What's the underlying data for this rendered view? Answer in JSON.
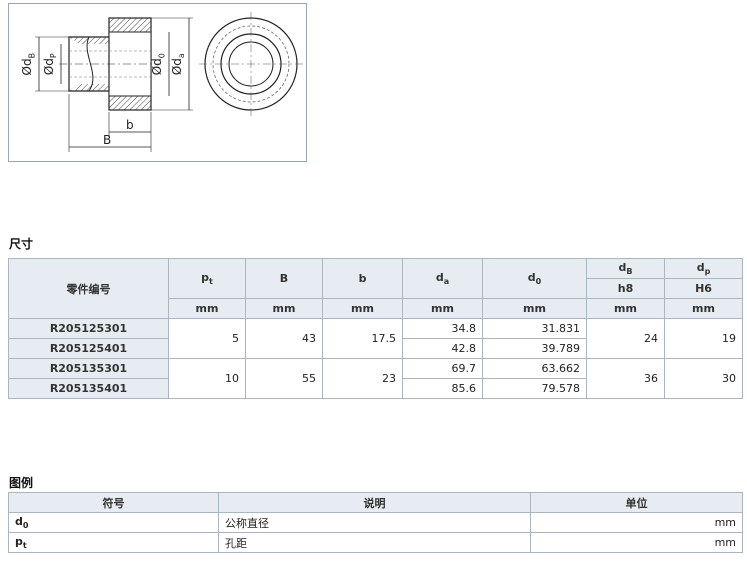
{
  "figure": {
    "labels": {
      "dB": "Ød",
      "dB_sub": "B",
      "dp": "Ød",
      "dp_sub": "P",
      "d0": "Ød",
      "d0_sub": "0",
      "da": "Ød",
      "da_sub": "a",
      "B": "B",
      "b": "b"
    }
  },
  "dimensions": {
    "title": "尺寸",
    "header": {
      "part_no": "零件编号",
      "pt": "p",
      "pt_sub": "t",
      "B": "B",
      "b": "b",
      "da": "d",
      "da_sub": "a",
      "d0": "d",
      "d0_sub": "0",
      "dB": "d",
      "dB_sub": "B",
      "dB_tol": "h8",
      "dp": "d",
      "dp_sub": "p",
      "dp_tol": "H6",
      "unit": "mm"
    },
    "groups": [
      {
        "pt": "5",
        "B": "43",
        "b": "17.5",
        "dB": "24",
        "dp": "19",
        "rows": [
          {
            "part": "R205125301",
            "da": "34.8",
            "d0": "31.831"
          },
          {
            "part": "R205125401",
            "da": "42.8",
            "d0": "39.789"
          }
        ]
      },
      {
        "pt": "10",
        "B": "55",
        "b": "23",
        "dB": "36",
        "dp": "30",
        "rows": [
          {
            "part": "R205135301",
            "da": "69.7",
            "d0": "63.662"
          },
          {
            "part": "R205135401",
            "da": "85.6",
            "d0": "79.578"
          }
        ]
      }
    ]
  },
  "legend": {
    "title": "图例",
    "header": {
      "symbol": "符号",
      "desc": "说明",
      "unit": "单位"
    },
    "rows": [
      {
        "sym": "d",
        "sym_sub": "0",
        "desc": "公称直径",
        "unit": "mm"
      },
      {
        "sym": "p",
        "sym_sub": "t",
        "desc": "孔距",
        "unit": "mm"
      }
    ]
  }
}
